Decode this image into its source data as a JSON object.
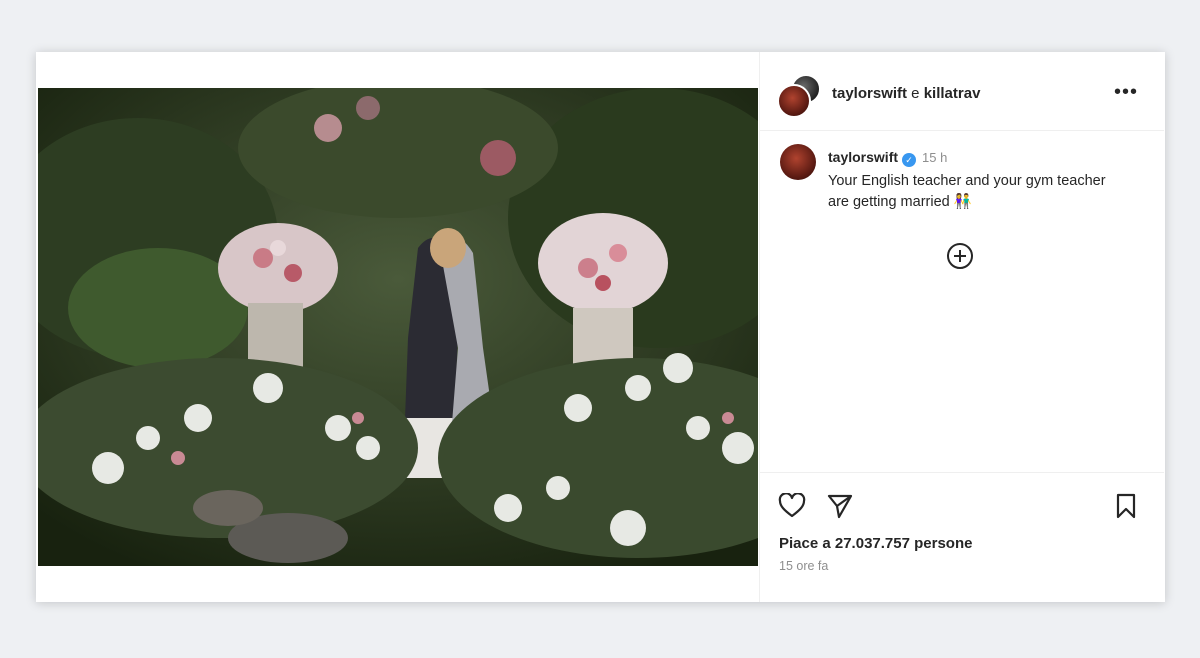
{
  "post": {
    "header": {
      "title_user1": "taylorswift",
      "title_joiner": " e ",
      "title_user2": "killatrav",
      "more_icon": "more-horizontal-icon"
    },
    "caption": {
      "username": "taylorswift",
      "verified_icon": "verified-badge-icon",
      "time": "15 h",
      "text": "Your English teacher and your gym teacher are getting married 👫"
    },
    "add_icon": "plus-circle-icon",
    "actions": {
      "like_icon": "heart-icon",
      "share_icon": "send-icon",
      "save_icon": "bookmark-icon"
    },
    "likes_text": "Piace a 27.037.757 persone",
    "time_ago": "15 ore fa"
  },
  "colors": {
    "text": "#262626",
    "muted": "#8e8e8e",
    "verified": "#3897f0",
    "divider": "#efefef"
  }
}
